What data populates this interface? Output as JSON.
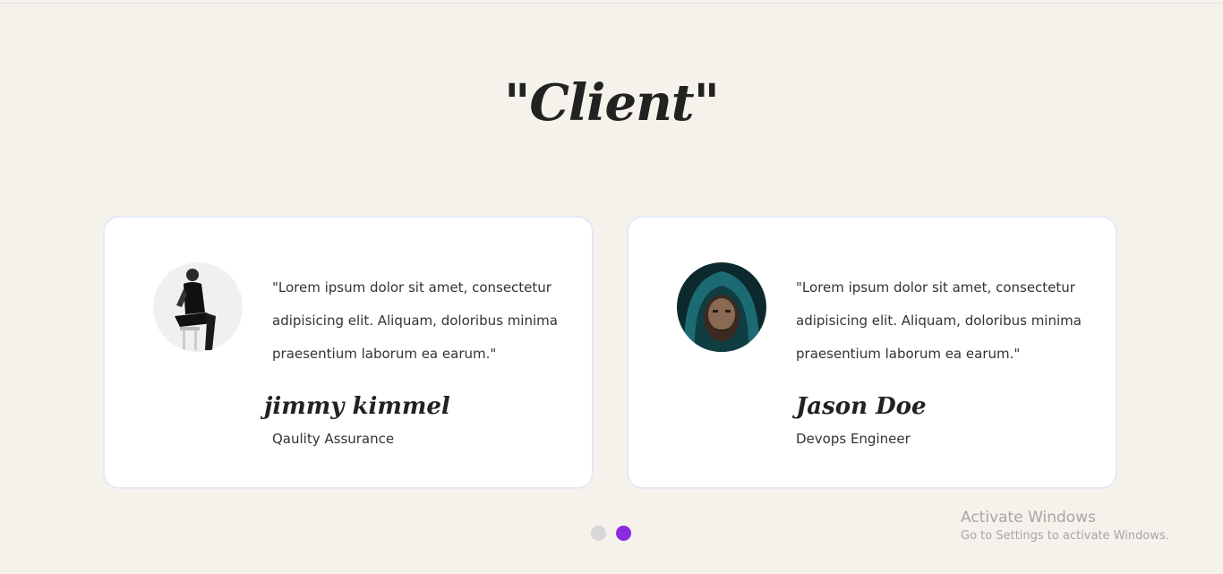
{
  "section": {
    "title": "\"Client\""
  },
  "testimonials": [
    {
      "avatar_icon": "person-sitting-avatar",
      "quote": "\"Lorem ipsum dolor sit amet, consectetur adipisicing elit. Aliquam, doloribus minima praesentium laborum ea earum.\"",
      "name": "jimmy kimmel",
      "role": "Qaulity Assurance"
    },
    {
      "avatar_icon": "hooded-man-avatar",
      "quote": "\"Lorem ipsum dolor sit amet, consectetur adipisicing elit. Aliquam, doloribus minima praesentium laborum ea earum.\"",
      "name": "Jason Doe",
      "role": "Devops Engineer"
    }
  ],
  "pagination": {
    "count": 2,
    "active_index": 1,
    "active_color": "#8a2be2",
    "inactive_color": "#d8d8d8"
  },
  "watermark": {
    "title": "Activate Windows",
    "subtitle": "Go to Settings to activate Windows."
  }
}
